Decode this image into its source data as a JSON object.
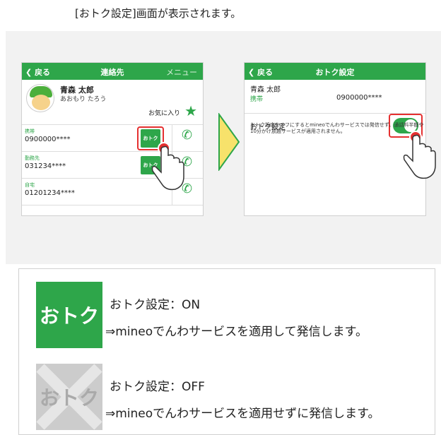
{
  "heading": "[おトク設定]画面が表示されます。",
  "left_phone": {
    "nav": {
      "back": "❮ 戻る",
      "title": "連絡先",
      "menu": "メニュー"
    },
    "contact": {
      "name": "青森 太郎",
      "kana": "あおもり たろう",
      "favorite": "お気に入り",
      "star": "★"
    },
    "rows": [
      {
        "label": "携帯",
        "number": "0900000****",
        "otoku": "おトク"
      },
      {
        "label": "勤務先",
        "number": "031234****",
        "otoku": "おトク"
      },
      {
        "label": "自宅",
        "number": "01201234****"
      }
    ],
    "phone_glyph": "✆"
  },
  "right_phone": {
    "nav": {
      "back": "❮ 戻る",
      "title": "おトク設定"
    },
    "name": "青森 太郎",
    "label": "携帯",
    "number": "0900000****",
    "setting_label": "おトク設定",
    "toggle_on": true,
    "description": "おトク設定をオフにするとmineoでんわサービスでは発信せず、通話料半額や10分かけ放題サービスが適用されません。"
  },
  "legend": {
    "on": {
      "badge": "おトク",
      "title": "おトク設定：ON",
      "desc": "⇒mineoでんわサービスを適用して発信します。"
    },
    "off": {
      "badge": "おトク",
      "title": "おトク設定：OFF",
      "desc": "⇒mineoでんわサービスを適用せずに発信します。"
    }
  },
  "colors": {
    "green": "#2ea64a",
    "red": "#e53030",
    "gray": "#cccccc"
  }
}
